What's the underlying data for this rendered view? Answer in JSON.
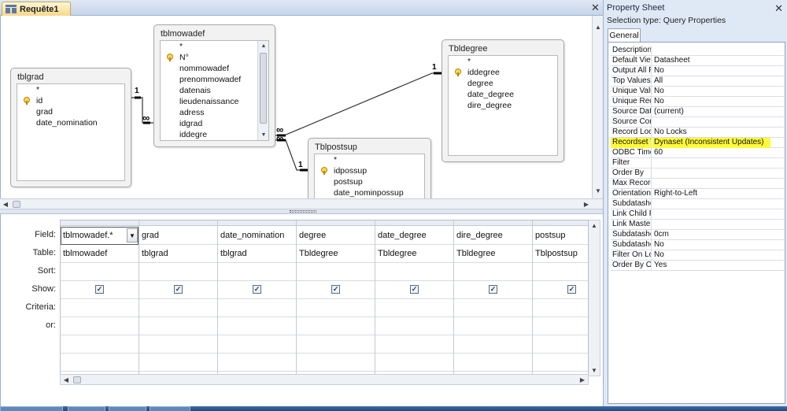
{
  "query": {
    "tab_label": "Requête1",
    "close_glyph": "✕"
  },
  "tables": {
    "tblgrad": {
      "title": "tblgrad",
      "fields": [
        "*",
        "id",
        "grad",
        "date_nomination"
      ]
    },
    "tblmowadef": {
      "title": "tblmowadef",
      "fields": [
        "*",
        "N°",
        "nommowadef",
        "prenommowadef",
        "datenais",
        "lieudenaissance",
        "adress",
        "idgrad",
        "iddegre"
      ]
    },
    "tbldegree": {
      "title": "Tbldegree",
      "fields": [
        "*",
        "iddegree",
        "degree",
        "date_degree",
        "dire_degree"
      ]
    },
    "tblpostsup": {
      "title": "Tblpostsup",
      "fields": [
        "*",
        "idpossup",
        "postsup",
        "date_nominpossup"
      ]
    }
  },
  "relationships": {
    "one": "1",
    "many": "∞"
  },
  "grid": {
    "row_labels": [
      "Field:",
      "Table:",
      "Sort:",
      "Show:",
      "Criteria:",
      "or:"
    ],
    "columns": [
      {
        "field": "tblmowadef.*",
        "table": "tblmowadef",
        "show": true
      },
      {
        "field": "grad",
        "table": "tblgrad",
        "show": true
      },
      {
        "field": "date_nomination",
        "table": "tblgrad",
        "show": true
      },
      {
        "field": "degree",
        "table": "Tbldegree",
        "show": true
      },
      {
        "field": "date_degree",
        "table": "Tbldegree",
        "show": true
      },
      {
        "field": "dire_degree",
        "table": "Tbldegree",
        "show": true
      },
      {
        "field": "postsup",
        "table": "Tblpostsup",
        "show": true
      }
    ],
    "check_glyph": "✓"
  },
  "property_sheet": {
    "title": "Property Sheet",
    "close_glyph": "✕",
    "selection_type": "Selection type:  Query Properties",
    "tab": "General",
    "properties": [
      {
        "name": "Description",
        "value": ""
      },
      {
        "name": "Default View",
        "value": "Datasheet"
      },
      {
        "name": "Output All Fields",
        "value": "No"
      },
      {
        "name": "Top Values",
        "value": "All"
      },
      {
        "name": "Unique Values",
        "value": "No"
      },
      {
        "name": "Unique Records",
        "value": "No"
      },
      {
        "name": "Source Database",
        "value": "(current)"
      },
      {
        "name": "Source Connect Str",
        "value": ""
      },
      {
        "name": "Record Locks",
        "value": "No Locks"
      },
      {
        "name": "Recordset Type",
        "value": "Dynaset (Inconsistent Updates)",
        "highlighted": true
      },
      {
        "name": "ODBC Timeout",
        "value": "60"
      },
      {
        "name": "Filter",
        "value": ""
      },
      {
        "name": "Order By",
        "value": ""
      },
      {
        "name": "Max Records",
        "value": ""
      },
      {
        "name": "Orientation",
        "value": "Right-to-Left"
      },
      {
        "name": "Subdatasheet Name",
        "value": ""
      },
      {
        "name": "Link Child Fields",
        "value": ""
      },
      {
        "name": "Link Master Fields",
        "value": ""
      },
      {
        "name": "Subdatasheet Height",
        "value": "0cm"
      },
      {
        "name": "Subdatasheet Expanded",
        "value": "No"
      },
      {
        "name": "Filter On Load",
        "value": "No"
      },
      {
        "name": "Order By On Load",
        "value": "Yes"
      }
    ]
  },
  "colors": {
    "chrome": "#dfe8f5",
    "tab_active": "#f8d88a",
    "highlight": "#fffb3a",
    "relation_line": "#333333"
  }
}
